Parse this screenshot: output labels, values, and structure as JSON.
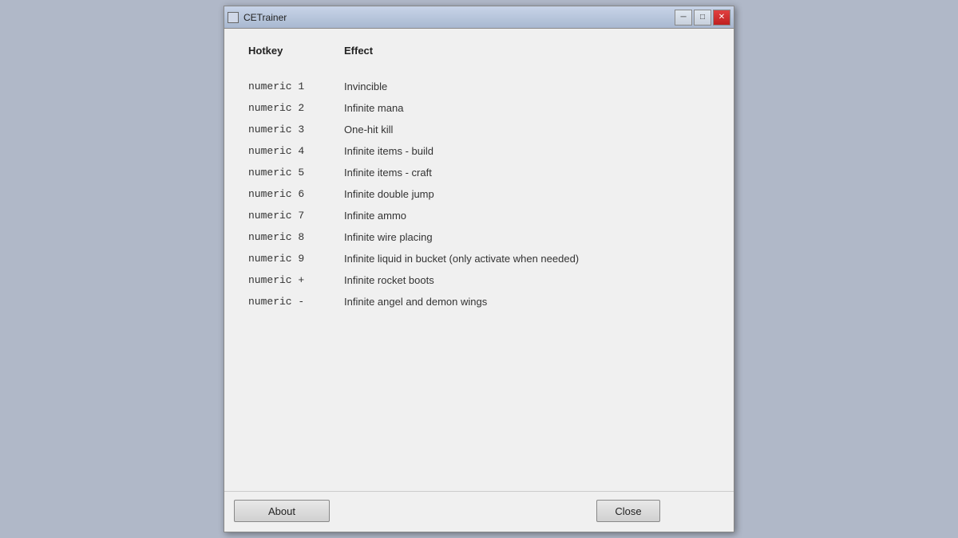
{
  "window": {
    "title": "CETrainer"
  },
  "title_buttons": {
    "minimize": "─",
    "restore": "□",
    "close": "✕"
  },
  "table": {
    "header": {
      "hotkey": "Hotkey",
      "effect": "Effect"
    },
    "rows": [
      {
        "hotkey": "numeric 1",
        "effect": "Invincible"
      },
      {
        "hotkey": "numeric 2",
        "effect": "Infinite mana"
      },
      {
        "hotkey": "numeric 3",
        "effect": "One-hit kill"
      },
      {
        "hotkey": "numeric 4",
        "effect": "Infinite items - build"
      },
      {
        "hotkey": "numeric 5",
        "effect": "Infinite items - craft"
      },
      {
        "hotkey": "numeric 6",
        "effect": "Infinite double jump"
      },
      {
        "hotkey": "numeric 7",
        "effect": "Infinite ammo"
      },
      {
        "hotkey": "numeric 8",
        "effect": "Infinite wire placing"
      },
      {
        "hotkey": "numeric 9",
        "effect": "Infinite liquid in bucket (only activate when needed)"
      },
      {
        "hotkey": "numeric +",
        "effect": "Infinite rocket boots"
      },
      {
        "hotkey": "numeric -",
        "effect": "Infinite angel and demon wings"
      }
    ]
  },
  "buttons": {
    "about": "About",
    "close": "Close"
  }
}
